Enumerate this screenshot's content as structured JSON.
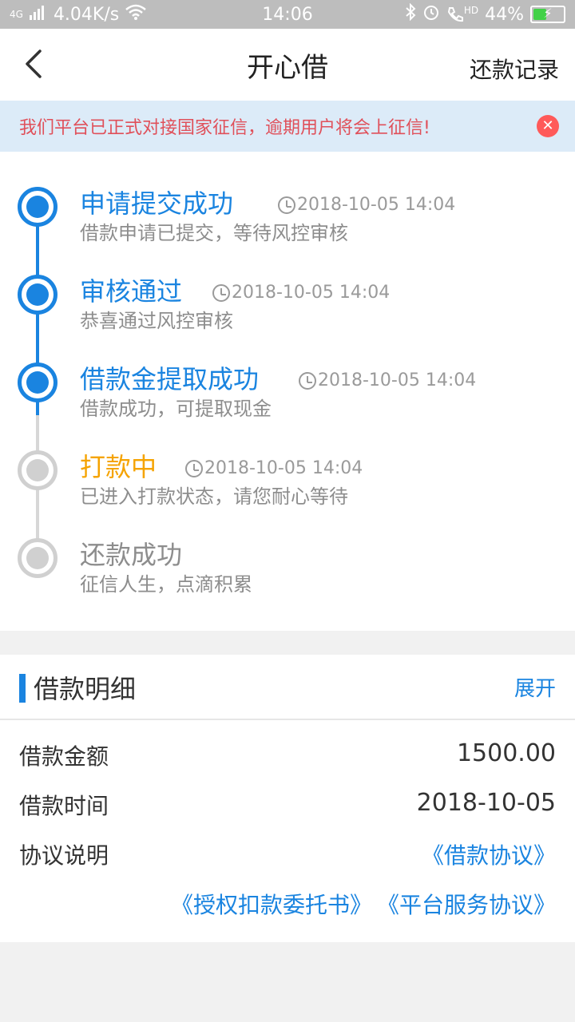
{
  "status_bar": {
    "network_type": "4G",
    "speed": "4.04K/s",
    "time": "14:06",
    "hd": "HD",
    "battery": "44%",
    "battery_level": 0.44
  },
  "nav": {
    "title": "开心借",
    "right_label": "还款记录"
  },
  "notice": {
    "text": "我们平台已正式对接国家征信，逾期用户将会上征信!"
  },
  "timeline": {
    "items": [
      {
        "title": "申请提交成功",
        "time": "2018-10-05 14:04",
        "desc": "借款申请已提交，等待风控审核",
        "state": "done"
      },
      {
        "title": "审核通过",
        "time": "2018-10-05 14:04",
        "desc": "恭喜通过风控审核",
        "state": "done"
      },
      {
        "title": "借款金提取成功",
        "time": "2018-10-05 14:04",
        "desc": "借款成功，可提取现金",
        "state": "done"
      },
      {
        "title": "打款中",
        "time": "2018-10-05 14:04",
        "desc": "已进入打款状态，请您耐心等待",
        "state": "current"
      },
      {
        "title": "还款成功",
        "time": "",
        "desc": "征信人生，点滴积累",
        "state": "pending"
      }
    ]
  },
  "detail": {
    "title": "借款明细",
    "toggle_label": "展开",
    "amount_label": "借款金额",
    "amount_value": "1500.00",
    "time_label": "借款时间",
    "time_value": "2018-10-05",
    "agreement_label": "协议说明",
    "agreement_link_1": "《借款协议》",
    "agreement_link_2": "《授权扣款委托书》",
    "agreement_link_3": "《平台服务协议》"
  },
  "colors": {
    "accent_blue": "#1a84e0",
    "pending_orange": "#f5a300",
    "notice_red": "#e0505a",
    "notice_bg": "#dcebf8"
  }
}
